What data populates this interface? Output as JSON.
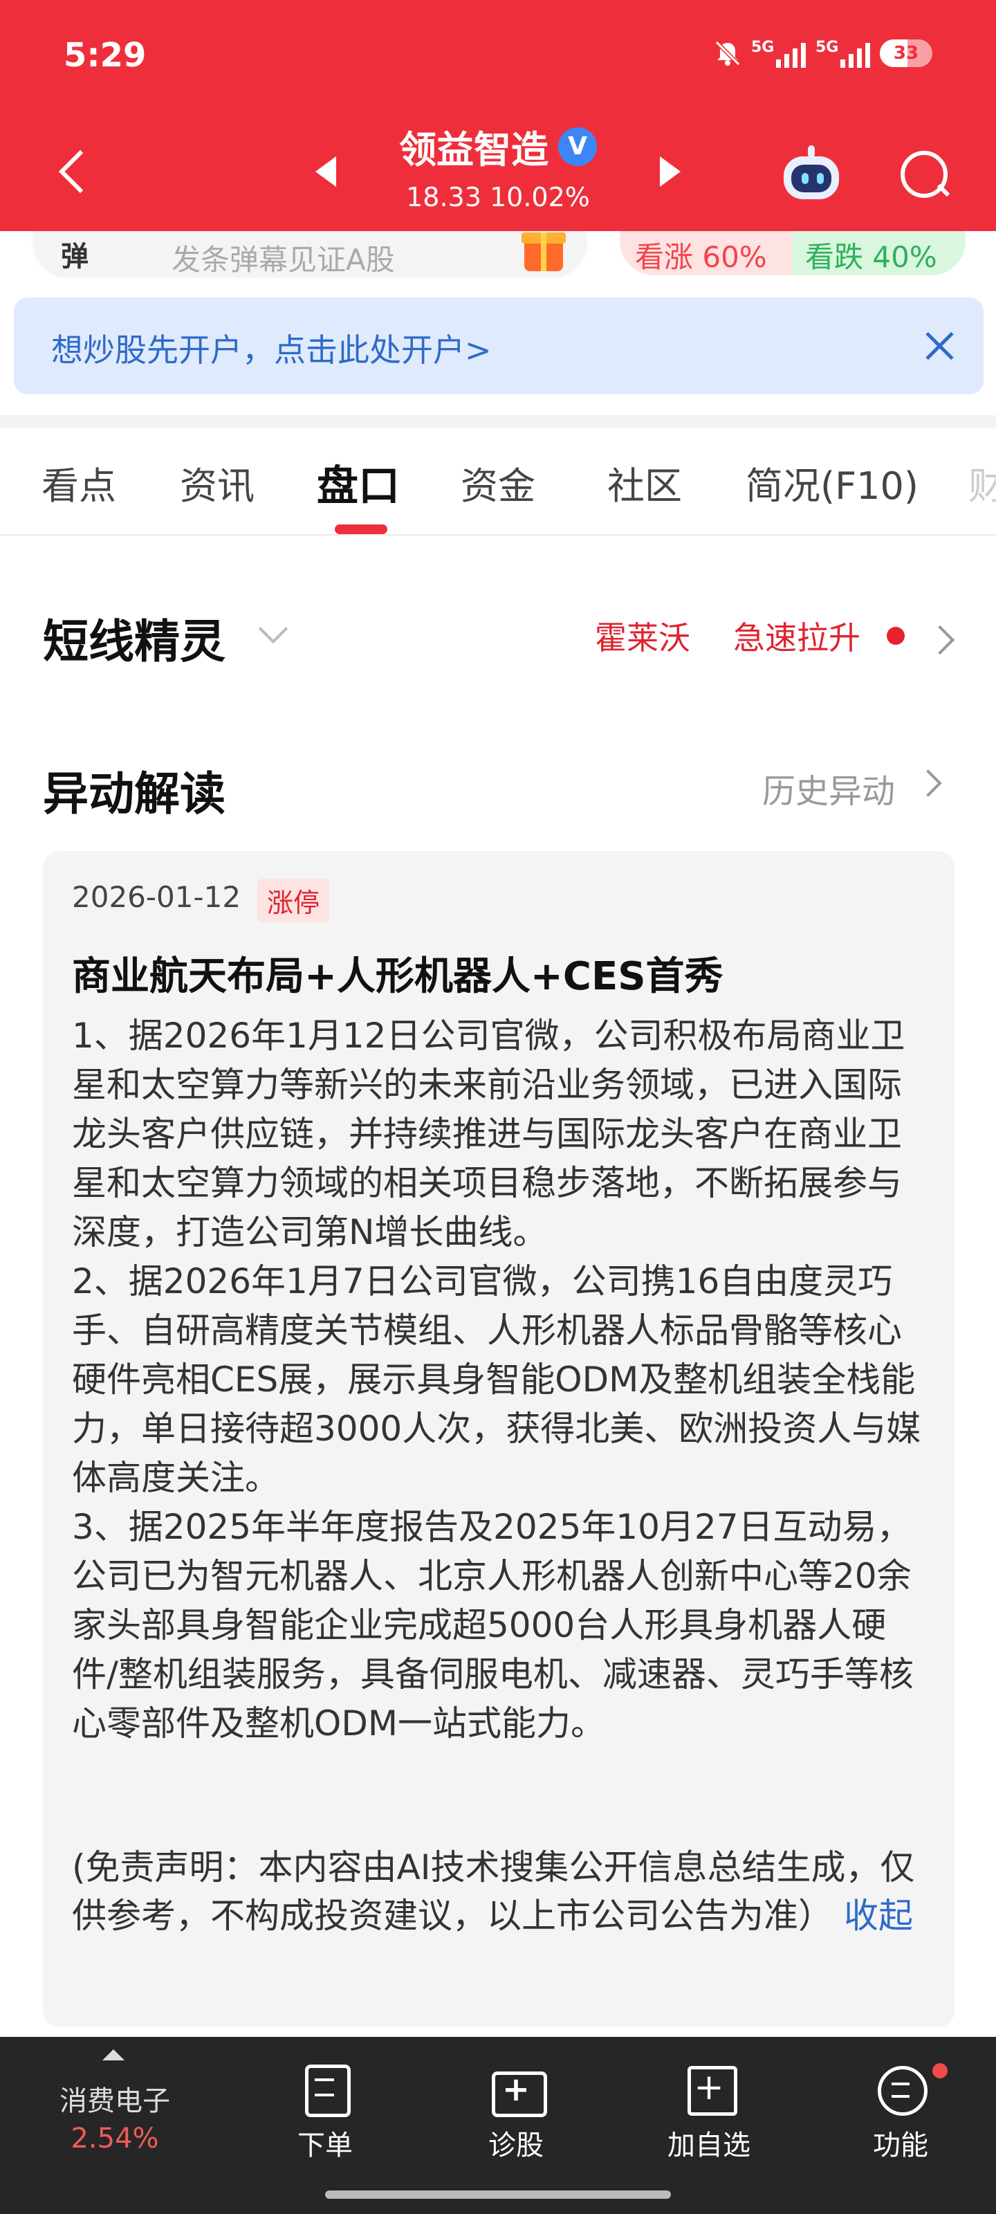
{
  "status_bar": {
    "time": "5:29",
    "network1": "5G",
    "network2": "5G",
    "battery": "33"
  },
  "header": {
    "stock_name": "领益智造",
    "verified_mark": "V",
    "price_line": "18.33 10.02%",
    "bg_color": "#ee2f3b"
  },
  "danmu": {
    "tag": "弹",
    "placeholder": "发条弹幕见证A股",
    "bullish": "看涨 60%",
    "bearish": "看跌 40%"
  },
  "banner": {
    "text": "想炒股先开户，点击此处开户>"
  },
  "tabs": [
    {
      "label": "看点"
    },
    {
      "label": "资讯"
    },
    {
      "label": "盘口"
    },
    {
      "label": "资金"
    },
    {
      "label": "社区"
    },
    {
      "label": "简况(F10)"
    },
    {
      "label": "财"
    }
  ],
  "short_line": {
    "title": "短线精灵",
    "tag1": "霍莱沃",
    "tag2": "急速拉升"
  },
  "anomaly": {
    "title": "异动解读",
    "history_link": "历史异动",
    "date": "2026-01-12",
    "badge": "涨停",
    "headline": "商业航天布局+人形机器人+CES首秀",
    "points": [
      "1、据2026年1月12日公司官微，公司积极布局商业卫星和太空算力等新兴的未来前沿业务领域，已进入国际龙头客户供应链，并持续推进与国际龙头客户在商业卫星和太空算力领域的相关项目稳步落地，不断拓展参与深度，打造公司第N增长曲线。",
      "2、据2026年1月7日公司官微，公司携16自由度灵巧手、自研高精度关节模组、人形机器人标品骨骼等核心硬件亮相CES展，展示具身智能ODM及整机组装全栈能力，单日接待超3000人次，获得北美、欧洲投资人与媒体高度关注。",
      "3、据2025年半年度报告及2025年10月27日互动易，公司已为智元机器人、北京人形机器人创新中心等20余家头部具身智能企业完成超5000台人形具身机器人硬件/整机组装服务，具备伺服电机、减速器、灵巧手等核心零部件及整机ODM一站式能力。"
    ],
    "disclaimer": "(免责声明：本内容由AI技术搜集公开信息总结生成，仅供参考，不构成投资建议，以上市公司公告为准）",
    "collapse": "收起"
  },
  "bottom_bar": {
    "sector_name": "消费电子",
    "sector_change": "2.54%",
    "items": [
      {
        "label": "下单"
      },
      {
        "label": "诊股"
      },
      {
        "label": "加自选"
      },
      {
        "label": "功能"
      }
    ]
  }
}
